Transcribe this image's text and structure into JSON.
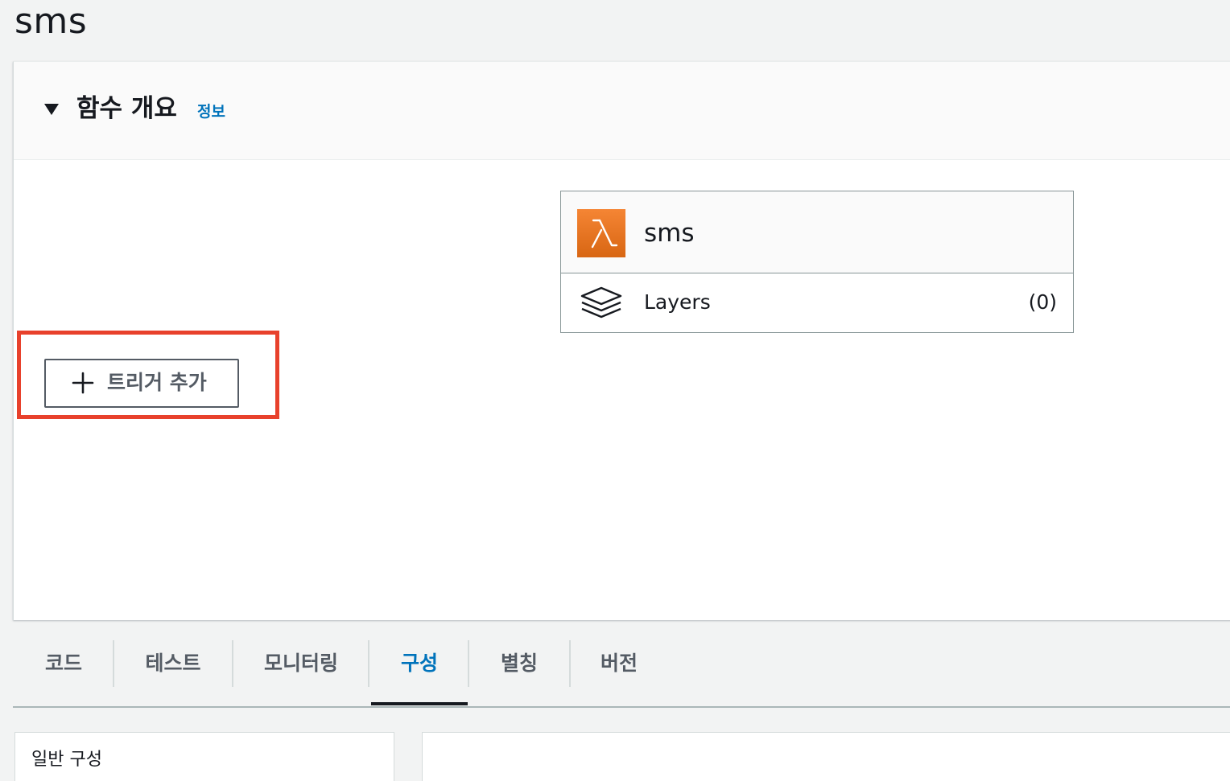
{
  "page": {
    "title": "sms"
  },
  "overview": {
    "title": "함수 개요",
    "info_link": "정보"
  },
  "function": {
    "name": "sms",
    "icon": "lambda-icon",
    "icon_color": "#e07b2a"
  },
  "layers": {
    "label": "Layers",
    "count": "(0)",
    "icon": "layers-icon"
  },
  "trigger": {
    "add_label": "트리거 추가",
    "icon": "plus-icon",
    "highlight_color": "#e8412c"
  },
  "tabs": [
    {
      "label": "코드",
      "active": false
    },
    {
      "label": "테스트",
      "active": false
    },
    {
      "label": "모니터링",
      "active": false
    },
    {
      "label": "구성",
      "active": true
    },
    {
      "label": "별칭",
      "active": false
    },
    {
      "label": "버전",
      "active": false
    }
  ],
  "config": {
    "left_card_title": "일반 구성"
  },
  "colors": {
    "accent": "#0073bb",
    "background": "#f2f3f3"
  }
}
